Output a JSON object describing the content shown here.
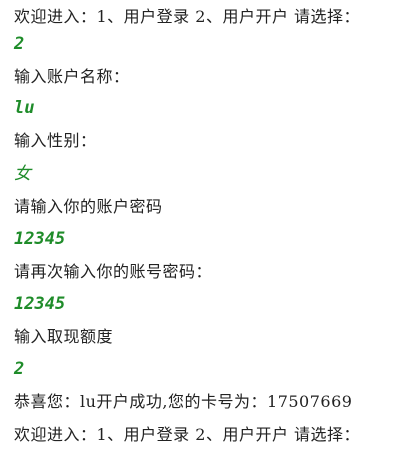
{
  "console": {
    "lines": [
      {
        "type": "prompt",
        "text": "欢迎进入：1、用户登录 2、用户开户 请选择："
      },
      {
        "type": "input",
        "text": "2"
      },
      {
        "type": "prompt",
        "text": "输入账户名称："
      },
      {
        "type": "input",
        "text": "lu"
      },
      {
        "type": "prompt",
        "text": "输入性别："
      },
      {
        "type": "input",
        "text": "女"
      },
      {
        "type": "prompt",
        "text": "请输入你的账户密码"
      },
      {
        "type": "input",
        "text": "12345"
      },
      {
        "type": "prompt",
        "text": "请再次输入你的账号密码："
      },
      {
        "type": "input",
        "text": "12345"
      },
      {
        "type": "prompt",
        "text": "输入取现额度"
      },
      {
        "type": "input",
        "text": "2"
      },
      {
        "type": "prompt",
        "text": "恭喜您：lu开户成功,您的卡号为：17507669"
      },
      {
        "type": "prompt",
        "text": "欢迎进入：1、用户登录 2、用户开户 请选择："
      }
    ]
  },
  "colors": {
    "input_text": "#1f8c2a",
    "output_text": "#222222",
    "background": "#ffffff"
  }
}
